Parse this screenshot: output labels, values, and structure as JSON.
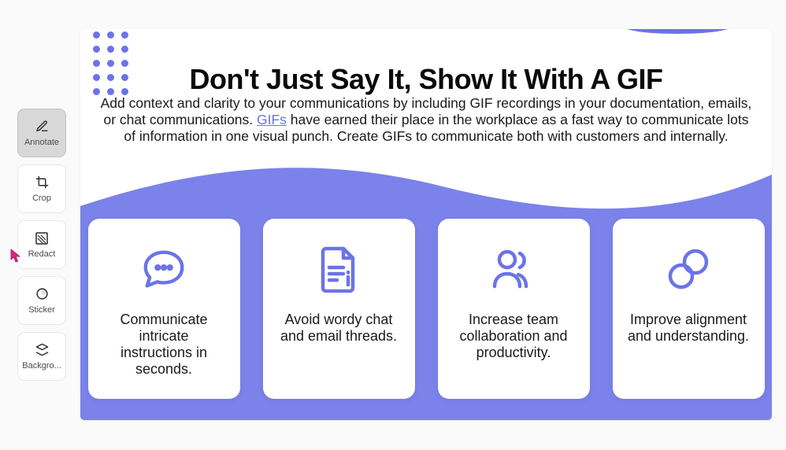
{
  "toolbar": {
    "annotate": "Annotate",
    "crop": "Crop",
    "redact": "Redact",
    "sticker": "Sticker",
    "background": "Backgro..."
  },
  "content": {
    "headline": "Don't Just Say It, Show It With A GIF",
    "subhead_before": "Add context and clarity to your communications by including GIF recordings in your documentation, emails, or chat communications. ",
    "subhead_link": "GIFs",
    "subhead_after": " have earned their place in the workplace as a fast way to communicate lots of information in one visual punch. Create GIFs to communicate both with customers and internally."
  },
  "cards": [
    {
      "text": "Communicate intricate instructions in seconds."
    },
    {
      "text": "Avoid wordy chat and email threads."
    },
    {
      "text": "Increase team collaboration and productivity."
    },
    {
      "text": "Improve alignment and understanding."
    }
  ],
  "colors": {
    "accent": "#6b73e8"
  }
}
